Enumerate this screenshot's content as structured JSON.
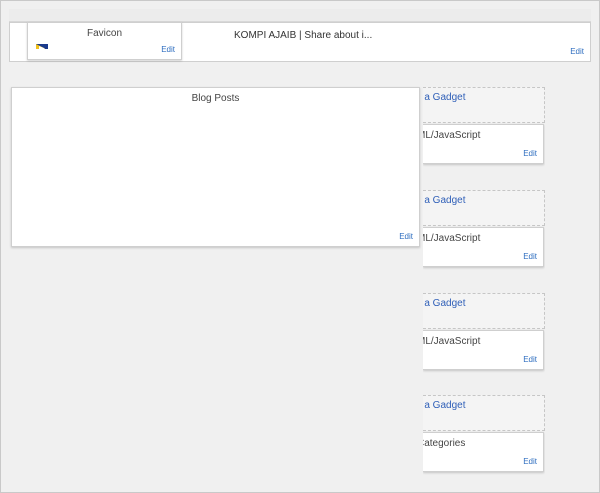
{
  "header": {
    "favicon_title": "Favicon",
    "favicon_edit": "Edit",
    "blog_title": "KOMPI AJAIB | Share about i...",
    "header_edit": "Edit"
  },
  "main": {
    "blog_posts_title": "Blog Posts",
    "blog_posts_edit": "Edit"
  },
  "sidebar": {
    "groups": [
      {
        "add_gadget": "d a Gadget",
        "widget_label": "ML/JavaScript",
        "edit": "Edit"
      },
      {
        "add_gadget": "d a Gadget",
        "widget_label": "ML/JavaScript",
        "edit": "Edit"
      },
      {
        "add_gadget": "d a Gadget",
        "widget_label": "ML/JavaScript",
        "edit": "Edit"
      },
      {
        "add_gadget": "d a Gadget",
        "widget_label": "Categories",
        "edit": "Edit"
      }
    ]
  },
  "colors": {
    "link_blue": "#2f6ec0",
    "border": "#cfcfcf",
    "canvas": "#f0f0f0"
  }
}
